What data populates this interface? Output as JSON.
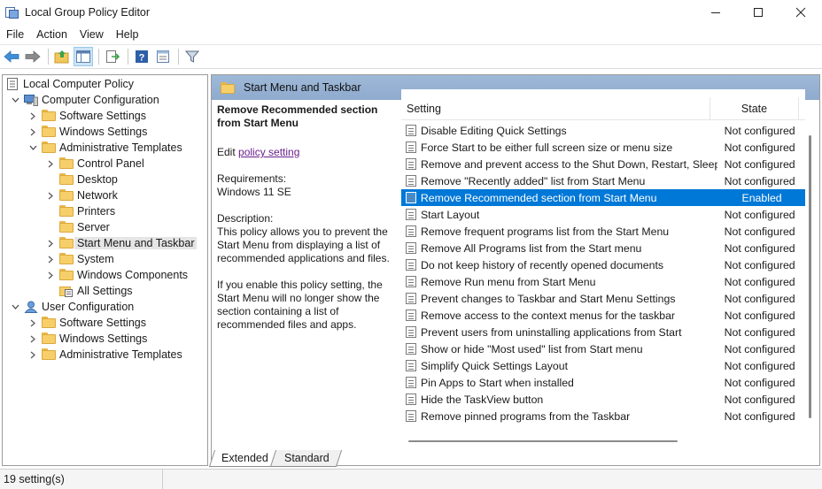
{
  "window": {
    "title": "Local Group Policy Editor",
    "controls": [
      "minimize",
      "maximize",
      "close"
    ]
  },
  "menubar": {
    "items": [
      "File",
      "Action",
      "View",
      "Help"
    ]
  },
  "toolbar": {
    "buttons": [
      {
        "icon": "back-arrow-icon"
      },
      {
        "icon": "forward-arrow-icon"
      },
      {
        "icon": "up-folder-icon"
      },
      {
        "icon": "show-hide-tree-icon",
        "active": true
      },
      {
        "icon": "export-list-icon"
      },
      {
        "icon": "help-icon"
      },
      {
        "icon": "properties-icon"
      },
      {
        "icon": "filter-icon"
      }
    ]
  },
  "tree": {
    "items": [
      {
        "label": "Local Computer Policy",
        "level": 0,
        "chevron": "none",
        "icon": "policy-icon"
      },
      {
        "label": "Computer Configuration",
        "level": 1,
        "chevron": "expanded",
        "icon": "computer-icon"
      },
      {
        "label": "Software Settings",
        "level": 2,
        "chevron": "collapsed",
        "icon": "folder-icon"
      },
      {
        "label": "Windows Settings",
        "level": 2,
        "chevron": "collapsed",
        "icon": "folder-icon"
      },
      {
        "label": "Administrative Templates",
        "level": 2,
        "chevron": "expanded",
        "icon": "folder-icon"
      },
      {
        "label": "Control Panel",
        "level": 3,
        "chevron": "collapsed",
        "icon": "folder-icon"
      },
      {
        "label": "Desktop",
        "level": 3,
        "chevron": "none",
        "icon": "folder-icon"
      },
      {
        "label": "Network",
        "level": 3,
        "chevron": "collapsed",
        "icon": "folder-icon"
      },
      {
        "label": "Printers",
        "level": 3,
        "chevron": "none",
        "icon": "folder-icon"
      },
      {
        "label": "Server",
        "level": 3,
        "chevron": "none",
        "icon": "folder-icon"
      },
      {
        "label": "Start Menu and Taskbar",
        "level": 3,
        "chevron": "collapsed",
        "icon": "folder-icon",
        "selected": true
      },
      {
        "label": "System",
        "level": 3,
        "chevron": "collapsed",
        "icon": "folder-icon"
      },
      {
        "label": "Windows Components",
        "level": 3,
        "chevron": "collapsed",
        "icon": "folder-icon"
      },
      {
        "label": "All Settings",
        "level": 3,
        "chevron": "none",
        "icon": "all-settings-icon"
      },
      {
        "label": "User Configuration",
        "level": 1,
        "chevron": "expanded",
        "icon": "user-icon"
      },
      {
        "label": "Software Settings",
        "level": 2,
        "chevron": "collapsed",
        "icon": "folder-icon"
      },
      {
        "label": "Windows Settings",
        "level": 2,
        "chevron": "collapsed",
        "icon": "folder-icon"
      },
      {
        "label": "Administrative Templates",
        "level": 2,
        "chevron": "collapsed",
        "icon": "folder-icon"
      }
    ]
  },
  "details": {
    "header_title": "Start Menu and Taskbar",
    "description": {
      "heading": "Remove Recommended section from Start Menu",
      "edit_prefix": "Edit ",
      "edit_link": "policy setting",
      "requirements_label": "Requirements:",
      "requirements_value": "Windows 11 SE",
      "description_label": "Description:",
      "description_p1": "This policy allows you to prevent the Start Menu from displaying a list of recommended applications and files.",
      "description_p2": "If you enable this policy setting, the Start Menu will no longer show the section containing a list of recommended files and apps."
    },
    "list": {
      "columns": [
        "Setting",
        "State"
      ],
      "rows": [
        {
          "setting": "Disable Editing Quick Settings",
          "state": "Not configured"
        },
        {
          "setting": "Force Start to be either full screen size or menu size",
          "state": "Not configured"
        },
        {
          "setting": "Remove and prevent access to the Shut Down, Restart, Sleep...",
          "state": "Not configured"
        },
        {
          "setting": "Remove \"Recently added\" list from Start Menu",
          "state": "Not configured"
        },
        {
          "setting": "Remove Recommended section from Start Menu",
          "state": "Enabled",
          "selected": true
        },
        {
          "setting": "Start Layout",
          "state": "Not configured"
        },
        {
          "setting": "Remove frequent programs list from the Start Menu",
          "state": "Not configured"
        },
        {
          "setting": "Remove All Programs list from the Start menu",
          "state": "Not configured"
        },
        {
          "setting": "Do not keep history of recently opened documents",
          "state": "Not configured"
        },
        {
          "setting": "Remove Run menu from Start Menu",
          "state": "Not configured"
        },
        {
          "setting": "Prevent changes to Taskbar and Start Menu Settings",
          "state": "Not configured"
        },
        {
          "setting": "Remove access to the context menus for the taskbar",
          "state": "Not configured"
        },
        {
          "setting": "Prevent users from uninstalling applications from Start",
          "state": "Not configured"
        },
        {
          "setting": "Show or hide \"Most used\" list from Start menu",
          "state": "Not configured"
        },
        {
          "setting": "Simplify Quick Settings Layout",
          "state": "Not configured"
        },
        {
          "setting": "Pin Apps to Start when installed",
          "state": "Not configured"
        },
        {
          "setting": "Hide the TaskView button",
          "state": "Not configured"
        },
        {
          "setting": "Remove pinned programs from the Taskbar",
          "state": "Not configured"
        }
      ]
    }
  },
  "tabs": {
    "extended": "Extended",
    "standard": "Standard",
    "active": "Extended"
  },
  "statusbar": {
    "text": "19 setting(s)"
  },
  "colors": {
    "selection": "#0078d7",
    "header_band": "#9fb9d8",
    "link": "#6b1f8f",
    "folder": "#f6cf6a"
  }
}
